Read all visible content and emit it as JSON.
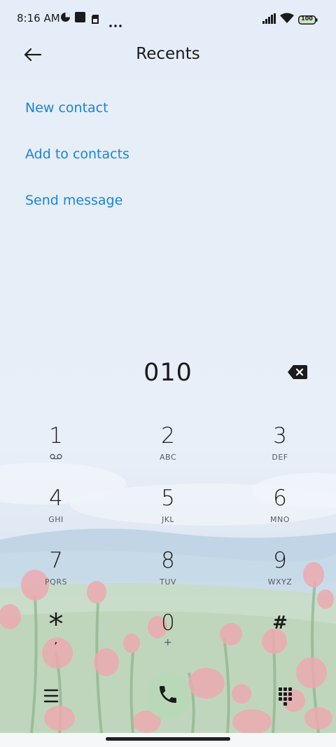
{
  "status_bar": {
    "time": "8:16 AM",
    "battery": "100",
    "icons": [
      "vpn-icon",
      "notification-square-icon",
      "sim-card-icon",
      "more-dots-icon",
      "signal-icon",
      "wifi-icon",
      "battery-icon"
    ]
  },
  "header": {
    "title": "Recents",
    "back_icon": "arrow-left-icon"
  },
  "actions": {
    "new_contact": "New contact",
    "add_to_contacts": "Add to contacts",
    "send_message": "Send message"
  },
  "dialer": {
    "number": "010",
    "backspace_icon": "backspace-icon"
  },
  "keypad": {
    "keys": [
      {
        "digit": "1",
        "letters": ""
      },
      {
        "digit": "2",
        "letters": "ABC"
      },
      {
        "digit": "3",
        "letters": "DEF"
      },
      {
        "digit": "4",
        "letters": "GHI"
      },
      {
        "digit": "5",
        "letters": "JKL"
      },
      {
        "digit": "6",
        "letters": "MNO"
      },
      {
        "digit": "7",
        "letters": "PQRS"
      },
      {
        "digit": "8",
        "letters": "TUV"
      },
      {
        "digit": "9",
        "letters": "WXYZ"
      },
      {
        "digit": "*",
        "letters": ","
      },
      {
        "digit": "0",
        "letters": "+"
      },
      {
        "digit": "#",
        "letters": ""
      }
    ]
  },
  "bottom_bar": {
    "menu_icon": "hamburger-menu-icon",
    "call_icon": "phone-icon",
    "dialpad_icon": "dialpad-grid-icon"
  },
  "colors": {
    "accent": "#1a84de",
    "call_button": "#b9d8b7",
    "text": "#1b1b1b"
  }
}
